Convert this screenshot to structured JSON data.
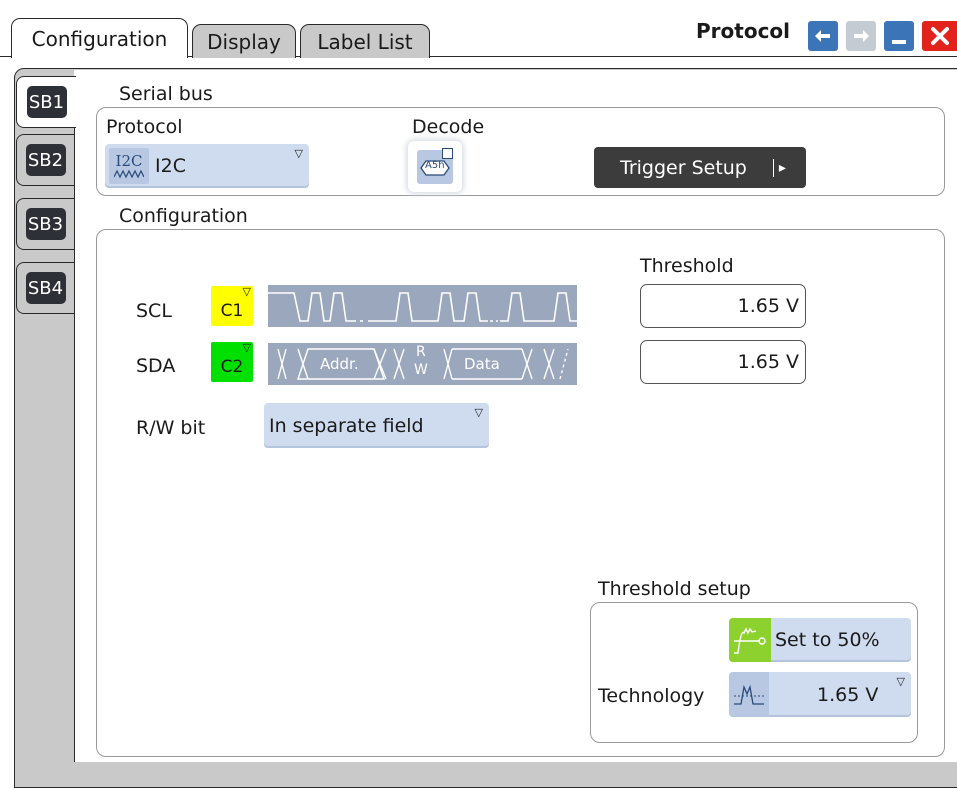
{
  "tabs": [
    {
      "label": "Configuration",
      "active": true
    },
    {
      "label": "Display",
      "active": false
    },
    {
      "label": "Label List",
      "active": false
    }
  ],
  "window": {
    "title": "Protocol"
  },
  "side_tabs": [
    {
      "label": "SB1",
      "active": true
    },
    {
      "label": "SB2",
      "active": false
    },
    {
      "label": "SB3",
      "active": false
    },
    {
      "label": "SB4",
      "active": false
    }
  ],
  "serial_bus": {
    "section_label": "Serial bus",
    "protocol_label": "Protocol",
    "protocol_value": "I2C",
    "protocol_icon_text": "I2C",
    "decode_label": "Decode",
    "decode_icon_text": "A5h",
    "trigger_setup_label": "Trigger Setup"
  },
  "configuration": {
    "section_label": "Configuration",
    "threshold_label": "Threshold",
    "scl": {
      "label": "SCL",
      "channel": "C1",
      "channel_color": "#ffff00",
      "threshold": "1.65 V"
    },
    "sda": {
      "label": "SDA",
      "channel": "C2",
      "channel_color": "#00e000",
      "threshold": "1.65 V",
      "wave_addr": "Addr.",
      "wave_rw_r": "R",
      "wave_rw_w": "W",
      "wave_data": "Data"
    },
    "rw_bit_label": "R/W bit",
    "rw_bit_value": "In separate field"
  },
  "threshold_setup": {
    "section_label": "Threshold setup",
    "set50_label": "Set to 50%",
    "technology_label": "Technology",
    "technology_value": "1.65 V"
  },
  "colors": {
    "accent_blue": "#3c74b8",
    "dropdown_bg": "#cfdcef",
    "close_red": "#e3221b",
    "wave_fill": "#9aa7bd"
  }
}
